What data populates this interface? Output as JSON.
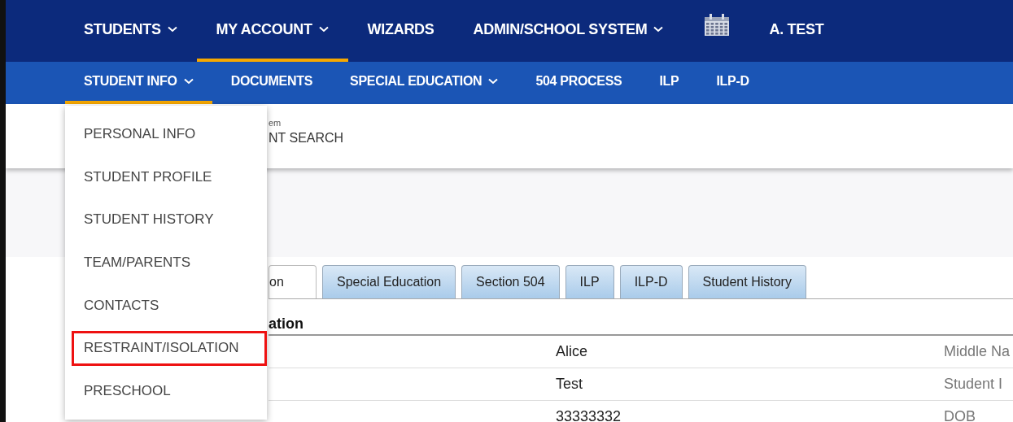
{
  "top_nav": {
    "items": [
      {
        "label": "STUDENTS",
        "dropdown": true,
        "selected": false
      },
      {
        "label": "MY ACCOUNT",
        "dropdown": true,
        "selected": true
      },
      {
        "label": "WIZARDS",
        "dropdown": false,
        "selected": false
      },
      {
        "label": "ADMIN/SCHOOL SYSTEM",
        "dropdown": true,
        "selected": false
      }
    ],
    "user": "A. TEST"
  },
  "sub_nav": {
    "items": [
      {
        "label": "STUDENT INFO",
        "dropdown": true,
        "selected": true
      },
      {
        "label": "DOCUMENTS",
        "dropdown": false,
        "selected": false
      },
      {
        "label": "SPECIAL EDUCATION",
        "dropdown": true,
        "selected": false
      },
      {
        "label": "504 PROCESS",
        "dropdown": false,
        "selected": false
      },
      {
        "label": "ILP",
        "dropdown": false,
        "selected": false
      },
      {
        "label": "ILP-D",
        "dropdown": false,
        "selected": false
      }
    ]
  },
  "breadcrumb": {
    "line_1": "em",
    "line_2": "NT SEARCH"
  },
  "dropdown": {
    "items": [
      {
        "label": "PERSONAL INFO",
        "highlighted": false
      },
      {
        "label": "STUDENT PROFILE",
        "highlighted": false
      },
      {
        "label": "STUDENT HISTORY",
        "highlighted": false
      },
      {
        "label": "TEAM/PARENTS",
        "highlighted": false
      },
      {
        "label": "CONTACTS",
        "highlighted": false
      },
      {
        "label": "RESTRAINT/ISOLATION",
        "highlighted": true
      },
      {
        "label": "PRESCHOOL",
        "highlighted": false
      }
    ]
  },
  "tabs": [
    {
      "label": "on",
      "selected": true
    },
    {
      "label": "Special Education",
      "selected": false
    },
    {
      "label": "Section 504",
      "selected": false
    },
    {
      "label": "ILP",
      "selected": false
    },
    {
      "label": "ILP-D",
      "selected": false
    },
    {
      "label": "Student History",
      "selected": false
    }
  ],
  "section": {
    "title": "ation",
    "rows": [
      {
        "value": "Alice",
        "label": "Middle Na"
      },
      {
        "value": "Test",
        "label": "Student I"
      },
      {
        "value": "33333332",
        "label": "DOB"
      }
    ]
  }
}
